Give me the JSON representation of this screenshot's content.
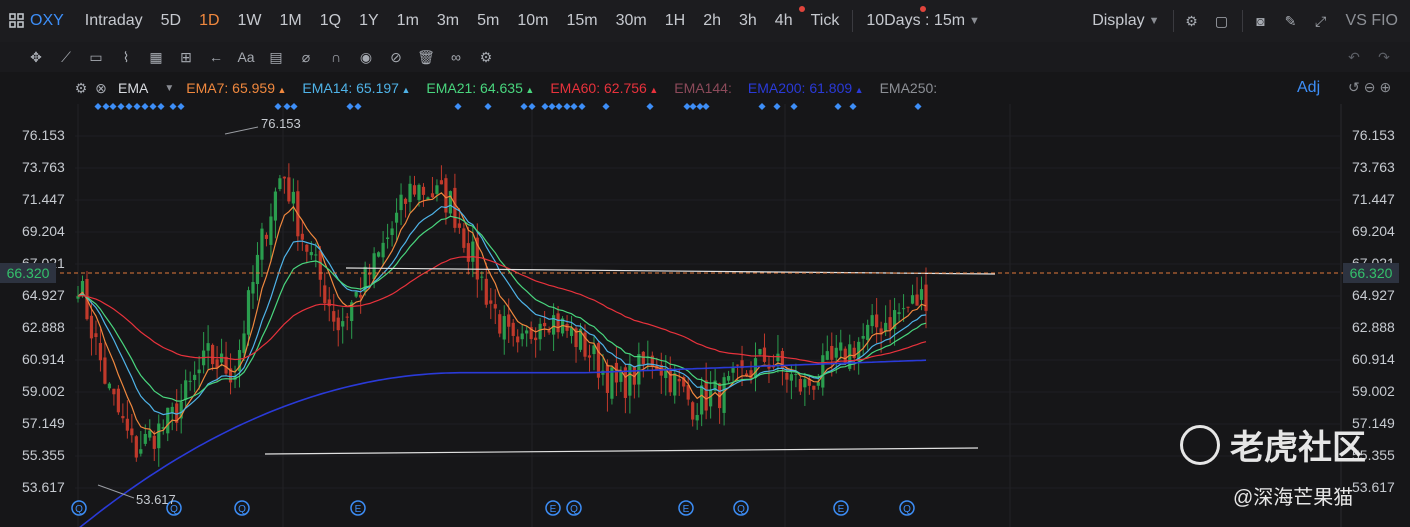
{
  "topbar": {
    "symbol": "OXY",
    "periods": [
      "Intraday",
      "5D",
      "1D",
      "1W",
      "1M",
      "1Q",
      "1Y",
      "1m",
      "3m",
      "5m",
      "10m",
      "15m",
      "30m",
      "1H",
      "2h",
      "3h",
      "4h",
      "Tick"
    ],
    "active_period": "1D",
    "range": "10Days : 15m",
    "display": "Display",
    "compare": "VS FIO"
  },
  "indicators": {
    "main": "EMA",
    "lines": [
      {
        "label": "EMA7:",
        "value": "65.959",
        "color": "#f0883e",
        "trend": "▲"
      },
      {
        "label": "EMA14:",
        "value": "65.197",
        "color": "#4fb3e8",
        "trend": "▲"
      },
      {
        "label": "EMA21:",
        "value": "64.635",
        "color": "#49d67e",
        "trend": "▲"
      },
      {
        "label": "EMA60:",
        "value": "62.756",
        "color": "#e8323c",
        "trend": "▲"
      },
      {
        "label": "EMA144:",
        "value": "",
        "color": "#8c4a5a",
        "trend": ""
      },
      {
        "label": "EMA200:",
        "value": "61.809",
        "color": "#2a3ad8",
        "trend": "▲"
      },
      {
        "label": "EMA250:",
        "value": "",
        "color": "#8c8f95",
        "trend": ""
      }
    ],
    "adj": "Adj"
  },
  "yaxis": {
    "labels": [
      "76.153",
      "73.763",
      "71.447",
      "69.204",
      "67.021",
      "64.927",
      "62.888",
      "60.914",
      "59.002",
      "57.149",
      "55.355",
      "53.617"
    ],
    "current_price": "66.320"
  },
  "annotations": {
    "high": "76.153",
    "low": "53.617"
  },
  "event_markers": [
    "Q",
    "Q",
    "Q",
    "E",
    "E",
    "Q",
    "E",
    "Q",
    "E",
    "Q"
  ],
  "watermark": {
    "brand": "老虎社区",
    "author": "@深海芒果猫"
  }
}
